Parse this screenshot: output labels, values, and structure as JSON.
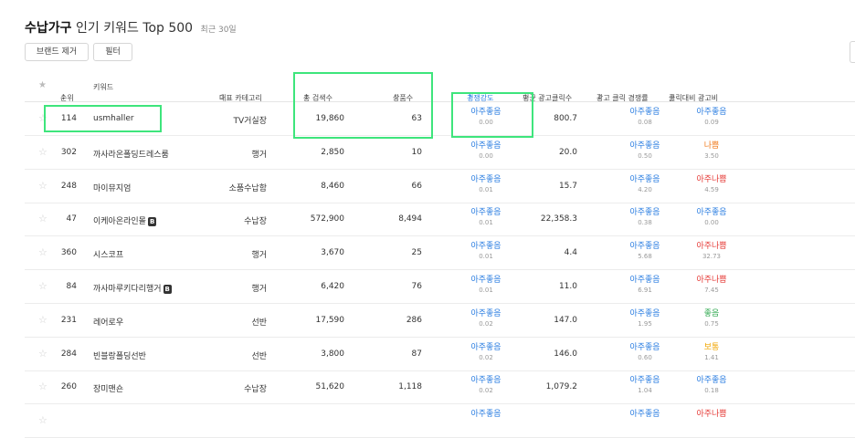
{
  "header": {
    "category": "수납가구",
    "title_rest": "인기 키워드 Top 500",
    "period": "최근 30일"
  },
  "toolbar": {
    "remove_brand_label": "브랜드 제거",
    "filter_label": "필터"
  },
  "columns": {
    "rank": "순위",
    "keyword": "키워드",
    "category": "대표 카테고리",
    "total_search": "총 검색수",
    "products": "상품수",
    "competition": "경쟁강도",
    "avg_ad_clicks": "평균 광고클릭수",
    "ad_click_competition": "광고 클릭 경쟁률",
    "ad_cost_per_click": "클릭대비 광고비"
  },
  "colors": {
    "very_good": "#2a7de1",
    "good": "#2fa84f",
    "normal": "#f0a500",
    "bad": "#f07b1e",
    "very_bad": "#e53935",
    "highlight": "#3ee57c"
  },
  "rows": [
    {
      "rank": "114",
      "keyword": "usmhaller",
      "brand": false,
      "category": "TV거실장",
      "search": "19,860",
      "products": "63",
      "comp_label": "아주좋음",
      "comp_value": "0.00",
      "avg_clicks": "800.7",
      "adcomp_label": "아주좋음",
      "adcomp_value": "0.08",
      "adcost_label": "아주좋음",
      "adcost_value": "0.09"
    },
    {
      "rank": "302",
      "keyword": "까사라온폴딩드레스룸",
      "brand": false,
      "category": "행거",
      "search": "2,850",
      "products": "10",
      "comp_label": "아주좋음",
      "comp_value": "0.00",
      "avg_clicks": "20.0",
      "adcomp_label": "아주좋음",
      "adcomp_value": "0.50",
      "adcost_label": "나쁨",
      "adcost_value": "3.50"
    },
    {
      "rank": "248",
      "keyword": "마이뮤지엄",
      "brand": false,
      "category": "소품수납함",
      "search": "8,460",
      "products": "66",
      "comp_label": "아주좋음",
      "comp_value": "0.01",
      "avg_clicks": "15.7",
      "adcomp_label": "아주좋음",
      "adcomp_value": "4.20",
      "adcost_label": "아주나쁨",
      "adcost_value": "4.59"
    },
    {
      "rank": "47",
      "keyword": "이케아온라인몰",
      "brand": true,
      "category": "수납장",
      "search": "572,900",
      "products": "8,494",
      "comp_label": "아주좋음",
      "comp_value": "0.01",
      "avg_clicks": "22,358.3",
      "adcomp_label": "아주좋음",
      "adcomp_value": "0.38",
      "adcost_label": "아주좋음",
      "adcost_value": "0.00"
    },
    {
      "rank": "360",
      "keyword": "시스코프",
      "brand": false,
      "category": "행거",
      "search": "3,670",
      "products": "25",
      "comp_label": "아주좋음",
      "comp_value": "0.01",
      "avg_clicks": "4.4",
      "adcomp_label": "아주좋음",
      "adcomp_value": "5.68",
      "adcost_label": "아주나쁨",
      "adcost_value": "32.73"
    },
    {
      "rank": "84",
      "keyword": "까사마루키다리행거",
      "brand": true,
      "category": "행거",
      "search": "6,420",
      "products": "76",
      "comp_label": "아주좋음",
      "comp_value": "0.01",
      "avg_clicks": "11.0",
      "adcomp_label": "아주좋음",
      "adcomp_value": "6.91",
      "adcost_label": "아주나쁨",
      "adcost_value": "7.45"
    },
    {
      "rank": "231",
      "keyword": "레어로우",
      "brand": false,
      "category": "선반",
      "search": "17,590",
      "products": "286",
      "comp_label": "아주좋음",
      "comp_value": "0.02",
      "avg_clicks": "147.0",
      "adcomp_label": "아주좋음",
      "adcomp_value": "1.95",
      "adcost_label": "좋음",
      "adcost_value": "0.75"
    },
    {
      "rank": "284",
      "keyword": "빈블랑폴딩선반",
      "brand": false,
      "category": "선반",
      "search": "3,800",
      "products": "87",
      "comp_label": "아주좋음",
      "comp_value": "0.02",
      "avg_clicks": "146.0",
      "adcomp_label": "아주좋음",
      "adcomp_value": "0.60",
      "adcost_label": "보통",
      "adcost_value": "1.41"
    },
    {
      "rank": "260",
      "keyword": "장미맨숀",
      "brand": false,
      "category": "수납장",
      "search": "51,620",
      "products": "1,118",
      "comp_label": "아주좋음",
      "comp_value": "0.02",
      "avg_clicks": "1,079.2",
      "adcomp_label": "아주좋음",
      "adcomp_value": "1.04",
      "adcost_label": "아주좋음",
      "adcost_value": "0.18"
    },
    {
      "rank": "",
      "keyword": "",
      "brand": false,
      "category": "",
      "search": "",
      "products": "",
      "comp_label": "아주좋음",
      "comp_value": "",
      "avg_clicks": "",
      "adcomp_label": "아주좋음",
      "adcomp_value": "",
      "adcost_label": "아주나쁨",
      "adcost_value": ""
    }
  ]
}
